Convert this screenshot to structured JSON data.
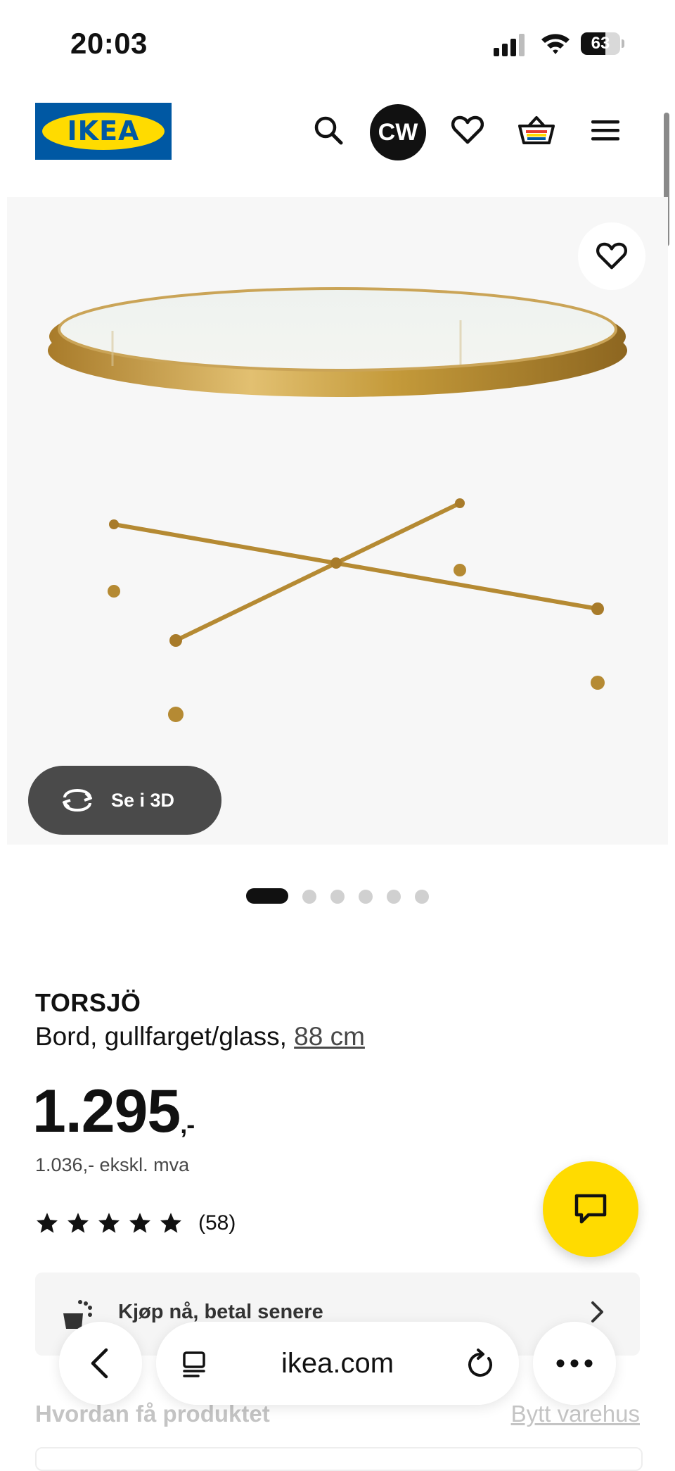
{
  "status_bar": {
    "time": "20:03",
    "battery": "63"
  },
  "header": {
    "brand": "IKEA",
    "avatar_initials": "CW"
  },
  "product": {
    "name": "TORSJÖ",
    "description": "Bord, gullfarget/glass,",
    "size": "88 cm",
    "price": "1.295",
    "price_suffix": ",-",
    "price_ex_vat": "1.036,- ekskl. mva",
    "rating_count": "(58)",
    "rating": 5,
    "rating_max": 5
  },
  "gallery": {
    "view_3d_label": "Se i 3D",
    "image_count": 6,
    "active_index": 0
  },
  "pay_later": {
    "label": "Kjøp nå, betal senere"
  },
  "availability": {
    "title": "Hvordan få produktet",
    "change_store": "Bytt varehus"
  },
  "browser": {
    "url": "ikea.com"
  },
  "colors": {
    "ikea_blue": "#0058a3",
    "ikea_yellow": "#ffdb00",
    "brass": "#c49a3a"
  }
}
